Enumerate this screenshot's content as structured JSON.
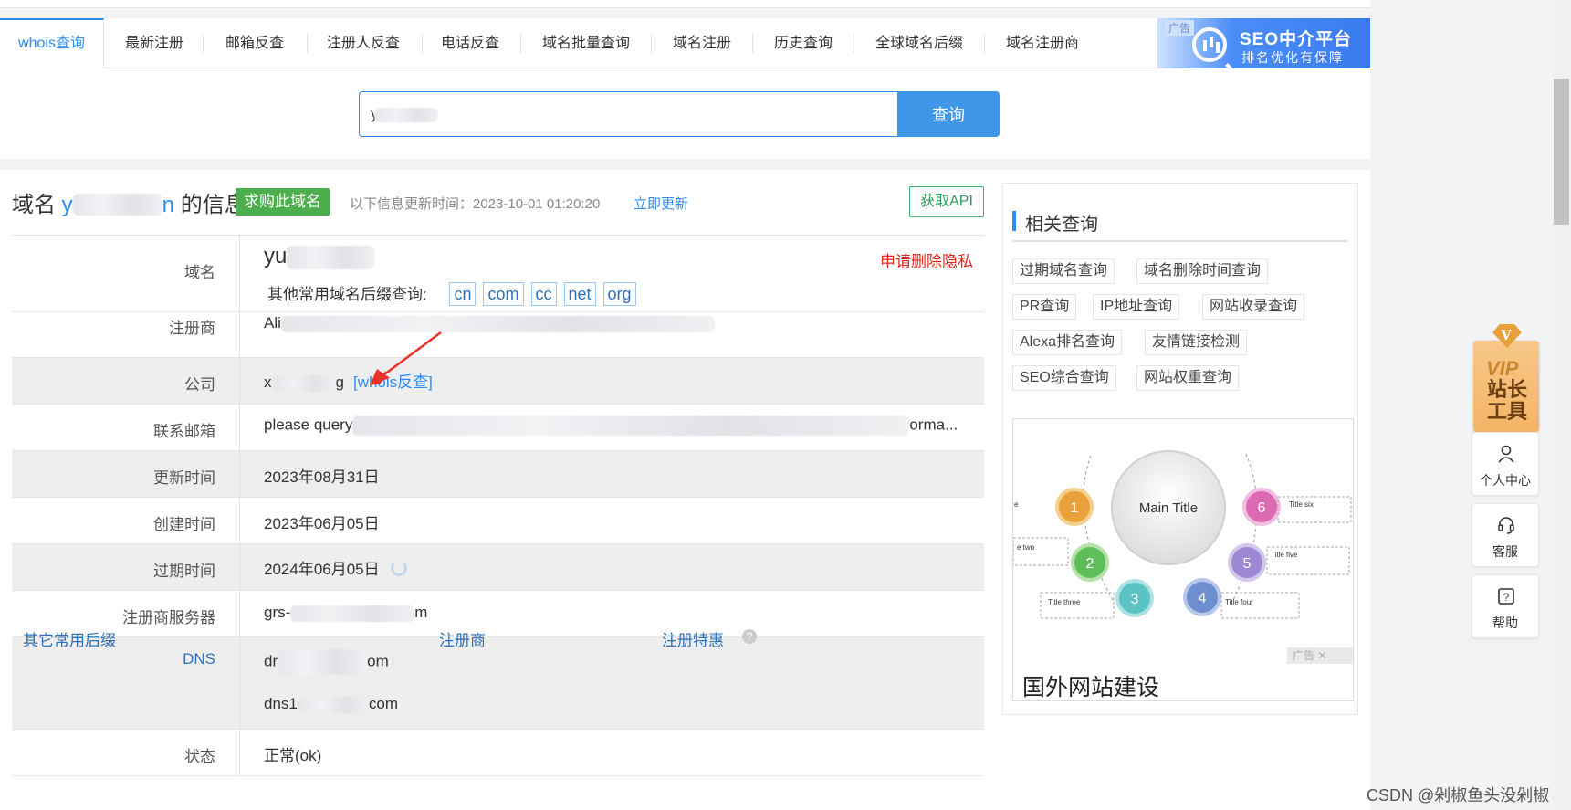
{
  "nav": {
    "tabs": [
      "whois查询",
      "最新注册",
      "邮箱反查",
      "注册人反查",
      "电话反查",
      "域名批量查询",
      "域名注册",
      "历史查询",
      "全球域名后缀",
      "域名注册商"
    ],
    "ad": {
      "tag": "广告",
      "title": "SEO中介平台",
      "subtitle": "排名优化有保障"
    }
  },
  "search": {
    "value": "y",
    "button": "查询"
  },
  "header": {
    "title_prefix": "域名 ",
    "title_domain_start": "y",
    "title_domain_end": "n",
    "title_suffix": " 的信息",
    "buy_button": "求购此域名",
    "update_text": "以下信息更新时间：2023-10-01 01:20:20",
    "update_link": "立即更新",
    "api_button": "获取API"
  },
  "rows": {
    "domain": {
      "label": "域名",
      "value": "yu",
      "privacy_link": "申请删除隐私",
      "suffix_label": "其他常用域名后缀查询:",
      "suffixes": [
        "cn",
        "com",
        "cc",
        "net",
        "org"
      ]
    },
    "registrar": {
      "label": "注册商",
      "value": "Ali"
    },
    "company": {
      "label": "公司",
      "value_start": "x",
      "value_end": "g",
      "link": "[whois反查]"
    },
    "email": {
      "label": "联系邮箱",
      "value_start": "please query",
      "value_end": "orma..."
    },
    "updated": {
      "label": "更新时间",
      "value": "2023年08月31日"
    },
    "created": {
      "label": "创建时间",
      "value": "2023年06月05日"
    },
    "expires": {
      "label": "过期时间",
      "value": "2024年06月05日"
    },
    "whois_server": {
      "label": "注册商服务器",
      "value_start": "grs-",
      "value_end": "m"
    },
    "dns": {
      "label": "DNS",
      "ns1_start": "dr",
      "ns1_end": "om",
      "ns2_start": "dns1",
      "ns2_end": "com"
    },
    "status": {
      "label": "状态",
      "value": "正常(ok)"
    }
  },
  "footer": {
    "col1": "其它常用后缀",
    "col2": "注册商",
    "col3": "注册特惠"
  },
  "related": {
    "title": "相关查询",
    "tags": [
      "过期域名查询",
      "域名删除时间查询",
      "PR查询",
      "IP地址查询",
      "网站收录查询",
      "Alexa排名查询",
      "友情链接检测",
      "SEO综合查询",
      "网站权重查询"
    ],
    "ad_caption": "国外网站建设",
    "ad_close": "广告 ✕",
    "diagram": {
      "center": "Main Title",
      "items": [
        "1",
        "2",
        "3",
        "4",
        "5",
        "6"
      ],
      "labels": [
        "e two",
        "Title three",
        "Title four",
        "Title five",
        "Title six",
        "e"
      ]
    }
  },
  "side": {
    "vip_badge": "V",
    "vip_text": "VIP",
    "vip_title": "站长工具",
    "buttons": [
      "个人中心",
      "客服",
      "帮助"
    ]
  },
  "watermark": "CSDN @剁椒鱼头没剁椒"
}
